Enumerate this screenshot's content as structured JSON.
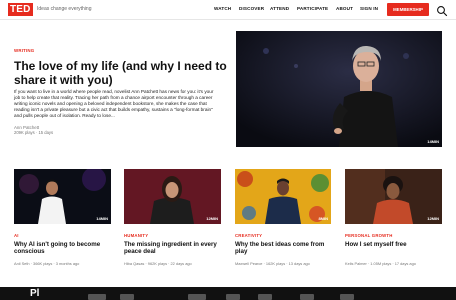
{
  "header": {
    "logo": "TED",
    "tagline": "Ideas change everything",
    "nav": [
      "WATCH",
      "DISCOVER",
      "ATTEND",
      "PARTICIPATE",
      "ABOUT",
      "SIGN IN"
    ],
    "member_label": "MEMBERSHIP"
  },
  "featured": {
    "category": "WRITING",
    "title": "The love of my life (and why I need to share it with you)",
    "description": "If you want to live in a world where people read, novelist Ann Patchett has news for you: it's your job to help create that reality. Tracing her path from a chance airport encounter through a career writing iconic novels and opening a beloved independent bookstore, she makes the case that reading isn't a private pleasure but a civic act that builds empathy, sustains a \"long-format brain\" and pulls people out of isolation. Ready to lose...",
    "author": "Ann Patchett",
    "stats": "209K plays · 15 days",
    "duration": "14MIN"
  },
  "cards": [
    {
      "category": "AI",
      "title": "Why AI isn't going to become conscious",
      "meta": "Anil Seth · 366K plays · 3 months ago",
      "duration": "14MIN"
    },
    {
      "category": "HUMANITY",
      "title": "The missing ingredient in every peace deal",
      "meta": "Hiba Qasas · 962K plays · 22 days ago",
      "duration": "12MIN"
    },
    {
      "category": "CREATIVITY",
      "title": "Why the best ideas come from play",
      "meta": "Maxwell Pearce · 162K plays · 13 days ago",
      "duration": "8MIN"
    },
    {
      "category": "PERSONAL GROWTH",
      "title": "How I set myself free",
      "meta": "Kelis Palmer · 1.05M plays · 17 days ago",
      "duration": "12MIN"
    }
  ],
  "bottom": {
    "text": "Pl"
  },
  "colors": {
    "accent": "#e62b1e",
    "text": "#111111",
    "muted": "#777777"
  }
}
